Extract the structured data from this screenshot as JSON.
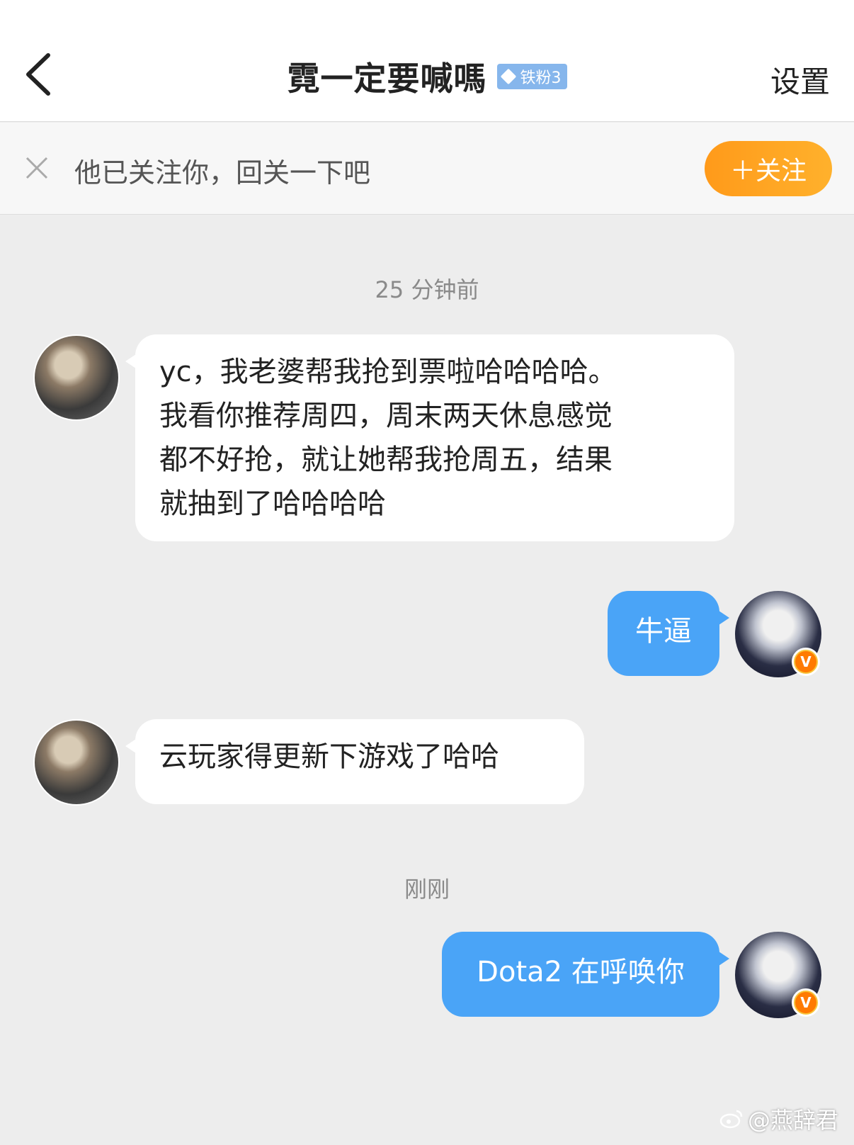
{
  "header": {
    "title": "霓一定要喊嗎",
    "fan_badge": "铁粉3",
    "settings_label": "设置"
  },
  "follow_bar": {
    "text": "他已关注你，回关一下吧",
    "button_label": "＋关注"
  },
  "messages": [
    {
      "timestamp": "25 分钟前"
    },
    {
      "sender": "other",
      "text_lines": [
        "yc，我老婆帮我抢到票啦哈哈哈哈。",
        "我看你推荐周四，周末两天休息感觉",
        "都不好抢，就让她帮我抢周五，结果",
        "就抽到了哈哈哈哈"
      ]
    },
    {
      "sender": "me",
      "text": "牛逼"
    },
    {
      "sender": "other",
      "text": "云玩家得更新下游戏了哈哈"
    },
    {
      "timestamp": "刚刚"
    },
    {
      "sender": "me",
      "text": "Dota2 在呼唤你"
    }
  ],
  "vip_label": "V",
  "watermark": "@燕辞君",
  "colors": {
    "my_bubble": "#4aa4f7",
    "follow_button": "#ff9a1a",
    "fan_badge": "#86b6ec"
  }
}
